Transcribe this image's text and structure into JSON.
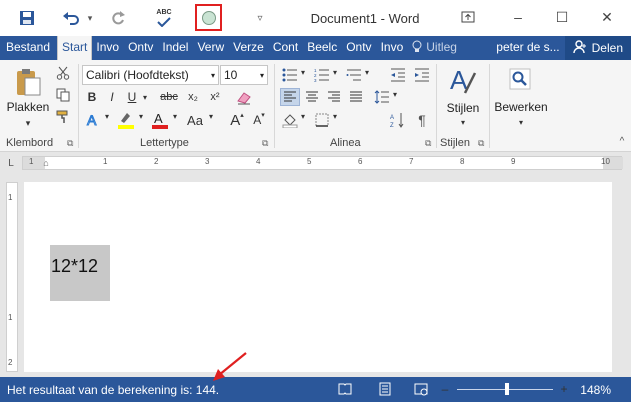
{
  "window": {
    "title": "Document1 - Word",
    "minimize": "–",
    "maximize": "☐",
    "close": "✕",
    "ribbon_options": "↑"
  },
  "quick_access": {
    "save_icon": "save-icon",
    "undo_icon": "undo-icon",
    "redo_icon": "redo-icon",
    "spelling_label": "ABC",
    "customize": "▿"
  },
  "tabs": [
    {
      "label": "Bestand"
    },
    {
      "label": "Start"
    },
    {
      "label": "Invo"
    },
    {
      "label": "Ontv"
    },
    {
      "label": "Indel"
    },
    {
      "label": "Verw"
    },
    {
      "label": "Verze"
    },
    {
      "label": "Cont"
    },
    {
      "label": "Beelc"
    },
    {
      "label": "Ontv"
    },
    {
      "label": "Invo"
    }
  ],
  "tell_me": "Uitleg",
  "user": "peter de s...",
  "share": "Delen",
  "ribbon": {
    "paste_label": "Plakken",
    "font_name": "Calibri (Hoofdtekst)",
    "font_size": "10",
    "bold": "B",
    "italic": "I",
    "underline": "U",
    "strike": "abc",
    "subscript": "x₂",
    "superscript": "x²",
    "case": "Aa",
    "grow": "A",
    "shrink": "A",
    "styles_label": "Stijlen",
    "editing_label": "Bewerken",
    "pilcrow": "¶",
    "groups": {
      "clipboard": "Klembord",
      "font": "Lettertype",
      "paragraph": "Alinea",
      "styles": "Stijlen"
    }
  },
  "ruler_ticks": [
    "1",
    "1",
    "2",
    "3",
    "4",
    "5",
    "6",
    "7",
    "8",
    "9",
    "10"
  ],
  "vruler_ticks": [
    "1",
    "1",
    "2"
  ],
  "document": {
    "cell_text": "12*12"
  },
  "statusbar": {
    "message": "Het resultaat van de berekening is: 144.",
    "zoom": "148%",
    "zoom_minus": "–",
    "zoom_plus": "+",
    "zoom_level": 0.52
  },
  "colors": {
    "accent": "#2b579a",
    "highlight_box": "#e02020",
    "text_highlight": "#ffff00",
    "font_color": "#e02020"
  }
}
